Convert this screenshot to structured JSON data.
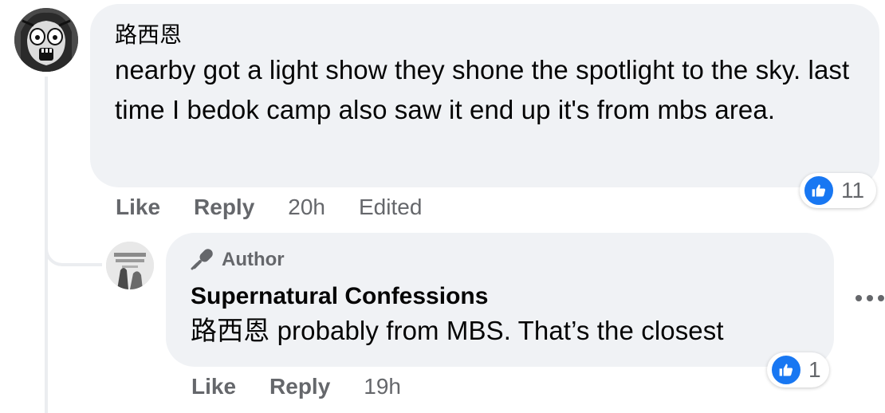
{
  "comments": [
    {
      "author": "路西恩",
      "text": "nearby got a light show they shone the spotlight to the sky. last time I bedok camp also saw it end up it's from mbs area.",
      "actions": {
        "like": "Like",
        "reply": "Reply",
        "time": "20h",
        "edited": "Edited"
      },
      "reactions": {
        "icon": "like-icon",
        "count": "11"
      }
    }
  ],
  "reply": {
    "badge": "Author",
    "badge_icon": "microphone-icon",
    "page_name": "Supernatural Confessions",
    "text": "路西恩 probably from MBS. That’s the closest",
    "actions": {
      "like": "Like",
      "reply": "Reply",
      "time": "19h"
    },
    "reactions": {
      "icon": "like-icon",
      "count": "1"
    }
  },
  "colors": {
    "bubble": "#f0f2f5",
    "meta_text": "#65676b",
    "like_blue": "#1877f2",
    "thread_line": "#ebedf0"
  }
}
